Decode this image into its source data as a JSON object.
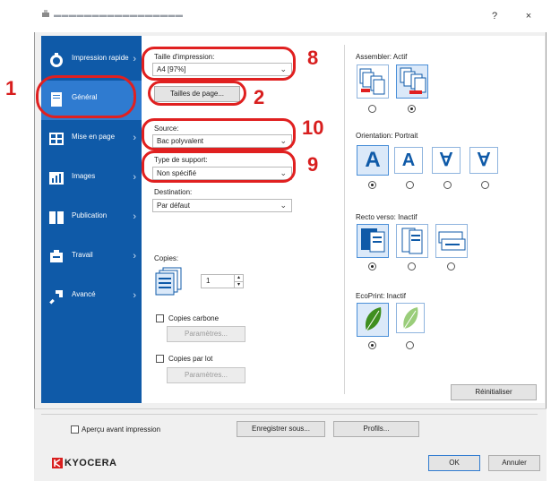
{
  "window": {
    "title": "▬▬▬▬▬▬▬▬▬▬▬▬▬▬▬▬▬",
    "help_label": "?",
    "close_label": "×"
  },
  "sidebar": {
    "items": [
      {
        "label": "Impression rapide",
        "icon": "quick-print-icon"
      },
      {
        "label": "Général",
        "icon": "document-icon"
      },
      {
        "label": "Mise en page",
        "icon": "layout-icon"
      },
      {
        "label": "Images",
        "icon": "image-icon"
      },
      {
        "label": "Publication",
        "icon": "publication-icon"
      },
      {
        "label": "Travail",
        "icon": "job-icon"
      },
      {
        "label": "Avancé",
        "icon": "advanced-arrow-icon"
      }
    ],
    "selected_index": 1
  },
  "general": {
    "print_size_label": "Taille d'impression:",
    "print_size_value": "A4 [97%]",
    "page_sizes_button": "Tailles de page...",
    "source_label": "Source:",
    "source_value": "Bac polyvalent",
    "media_type_label": "Type de support:",
    "media_type_value": "Non spécifié",
    "destination_label": "Destination:",
    "destination_value": "Par défaut",
    "copies_label": "Copies:",
    "copies_value": "1",
    "carbon_copies_label": "Copies carbone",
    "carbon_params_button": "Paramètres...",
    "copies_per_lot_label": "Copies par lot",
    "lot_params_button": "Paramètres..."
  },
  "right_panel": {
    "collate_label": "Assembler: Actif",
    "orientation_label": "Orientation: Portrait",
    "orientation_letters": [
      "A",
      "A",
      "∀",
      "∀"
    ],
    "duplex_label": "Recto verso: Inactif",
    "ecoprint_label": "EcoPrint: Inactif",
    "reset_button": "Réinitialiser"
  },
  "bottom": {
    "preview_label": "Aperçu avant impression",
    "save_as_button": "Enregistrer sous...",
    "profiles_button": "Profils...",
    "logo_text": "KYOCERA",
    "ok_button": "OK",
    "cancel_button": "Annuler"
  },
  "annotations": {
    "n1": "1",
    "n2": "2",
    "n8": "8",
    "n9": "9",
    "n10": "10"
  },
  "colors": {
    "sidebar": "#0f5aa8",
    "sidebar_selected": "#2f7bd0",
    "annotation": "#e02020",
    "ecoprint_leaf": "#5aa02c"
  }
}
